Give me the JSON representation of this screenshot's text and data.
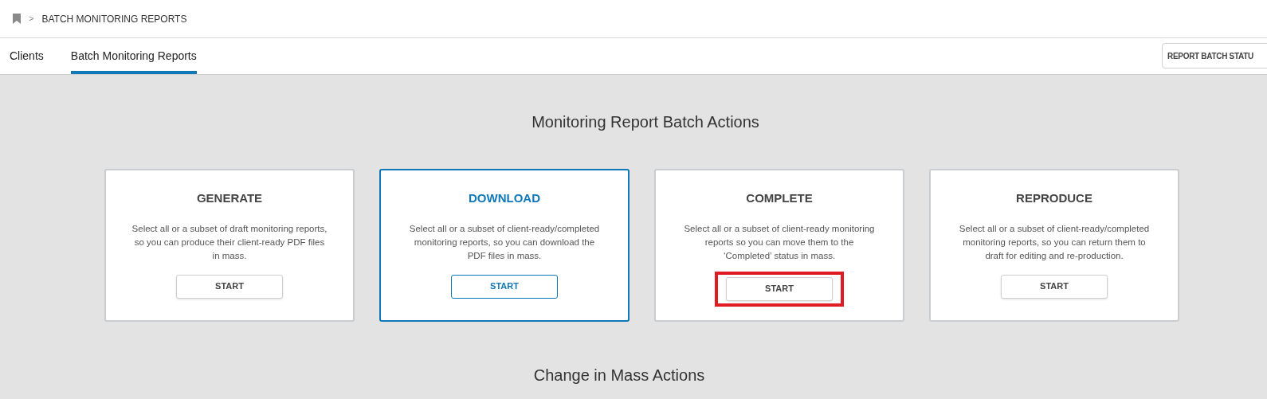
{
  "breadcrumb": {
    "separator": ">",
    "current": "BATCH MONITORING REPORTS"
  },
  "tabs": [
    {
      "label": "Clients",
      "selected": false
    },
    {
      "label": "Batch Monitoring Reports",
      "selected": true
    }
  ],
  "toolbar_button": "REPORT BATCH STATU",
  "section_title": "Monitoring Report Batch Actions",
  "cards": [
    {
      "title": "GENERATE",
      "description": "Select all or a subset of draft monitoring reports, so you can produce their client-ready PDF files in mass.",
      "button": "START",
      "selected": false,
      "annotated": false
    },
    {
      "title": "DOWNLOAD",
      "description": "Select all or a subset of client-ready/completed monitoring reports, so you can download the PDF files in mass.",
      "button": "START",
      "selected": true,
      "annotated": false
    },
    {
      "title": "COMPLETE",
      "description": "Select all or a subset of client-ready monitoring reports so you can move them to the ‘Completed’ status in mass.",
      "button": "START",
      "selected": false,
      "annotated": true
    },
    {
      "title": "REPRODUCE",
      "description": "Select all or a subset of client-ready/completed monitoring reports, so you can return them to draft for editing and re-production.",
      "button": "START",
      "selected": false,
      "annotated": false
    }
  ],
  "next_section_title": "Change in Mass Actions"
}
